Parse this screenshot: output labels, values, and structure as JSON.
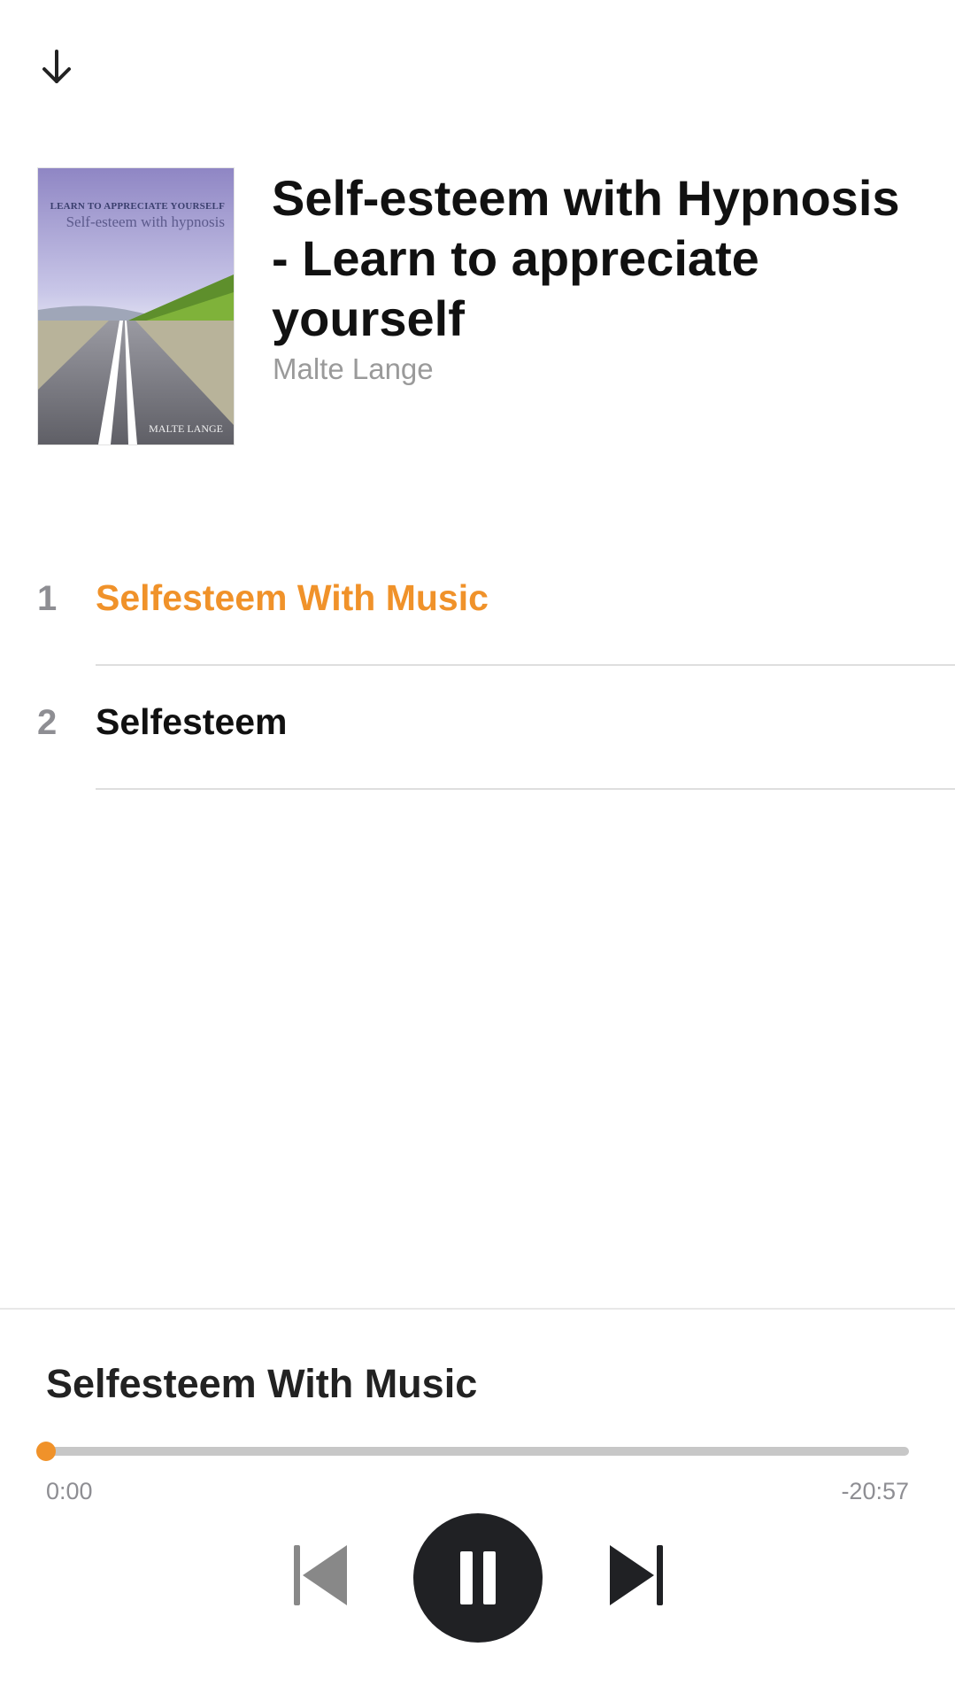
{
  "header": {
    "collapse_icon": "arrow-down-icon"
  },
  "book": {
    "title": "Self-esteem with Hypnosis - Learn to appreciate yourself",
    "author": "Malte Lange",
    "cover": {
      "kicker": "LEARN TO APPRECIATE YOURSELF",
      "title": "Self-esteem with hypnosis",
      "author": "MALTE LANGE"
    }
  },
  "tracks": [
    {
      "number": "1",
      "name": "Selfesteem With Music",
      "active": true
    },
    {
      "number": "2",
      "name": "Selfesteem",
      "active": false
    }
  ],
  "player": {
    "now_playing": "Selfesteem With Music",
    "elapsed": "0:00",
    "remaining": "-20:57",
    "progress": 0.0,
    "state": "playing",
    "accent_color": "#f0922a"
  }
}
